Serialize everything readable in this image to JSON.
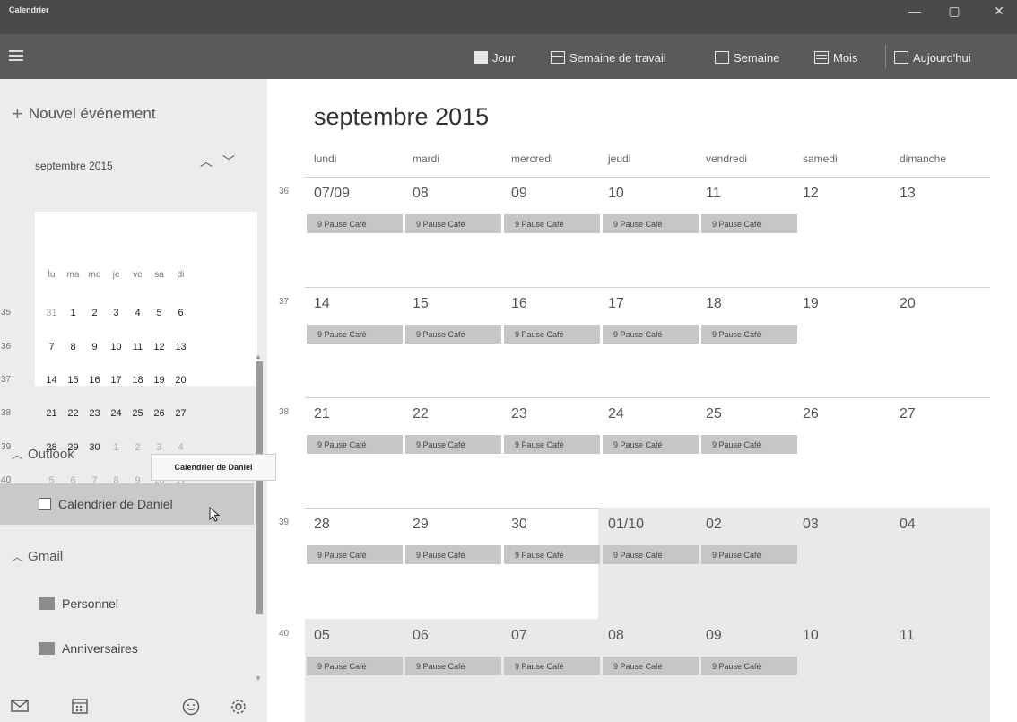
{
  "app": {
    "title": "Calendrier",
    "window_controls": {
      "minimize": "—",
      "maximize": "▢",
      "close": "✕"
    }
  },
  "toolbar": {
    "views": [
      {
        "label": "Jour",
        "icon": "day-view-icon"
      },
      {
        "label": "Semaine de travail",
        "icon": "workweek-view-icon"
      },
      {
        "label": "Semaine",
        "icon": "week-view-icon"
      },
      {
        "label": "Mois",
        "icon": "month-view-icon"
      },
      {
        "label": "Aujourd'hui",
        "icon": "today-icon"
      }
    ]
  },
  "sidebar": {
    "new_event": "Nouvel événement",
    "mini_calendar": {
      "title": "septembre 2015",
      "weekday_headers": [
        "lu",
        "ma",
        "me",
        "je",
        "ve",
        "sa",
        "di"
      ],
      "weeks": [
        {
          "week": "35",
          "days": [
            "31",
            "1",
            "2",
            "3",
            "4",
            "5",
            "6"
          ]
        },
        {
          "week": "36",
          "days": [
            "7",
            "8",
            "9",
            "10",
            "11",
            "12",
            "13"
          ]
        },
        {
          "week": "37",
          "days": [
            "14",
            "15",
            "16",
            "17",
            "18",
            "19",
            "20"
          ]
        },
        {
          "week": "38",
          "days": [
            "21",
            "22",
            "23",
            "24",
            "25",
            "26",
            "27"
          ]
        },
        {
          "week": "39",
          "days": [
            "28",
            "29",
            "30",
            "1",
            "2",
            "3",
            "4"
          ]
        },
        {
          "week": "40",
          "days": [
            "5",
            "6",
            "7",
            "8",
            "9",
            "10",
            "11"
          ]
        }
      ]
    },
    "groups": [
      {
        "name": "Outlook",
        "calendars": [
          "Calendrier de Daniel"
        ]
      },
      {
        "name": "Gmail",
        "calendars": [
          "Personnel",
          "Anniversaires"
        ]
      }
    ],
    "tooltip": "Calendrier de Daniel"
  },
  "main": {
    "month_title": "septembre 2015",
    "weekdays": [
      "lundi",
      "mardi",
      "mercredi",
      "jeudi",
      "vendredi",
      "samedi",
      "dimanche"
    ],
    "weeks": [
      {
        "week": "36",
        "days": [
          "07/09",
          "08",
          "09",
          "10",
          "11",
          "12",
          "13"
        ]
      },
      {
        "week": "37",
        "days": [
          "14",
          "15",
          "16",
          "17",
          "18",
          "19",
          "20"
        ]
      },
      {
        "week": "38",
        "days": [
          "21",
          "22",
          "23",
          "24",
          "25",
          "26",
          "27"
        ]
      },
      {
        "week": "39",
        "days": [
          "28",
          "29",
          "30",
          "01/10",
          "02",
          "03",
          "04"
        ]
      },
      {
        "week": "40",
        "days": [
          "05",
          "06",
          "07",
          "08",
          "09",
          "10",
          "11"
        ]
      }
    ],
    "event_label": "9 Pause Café"
  }
}
